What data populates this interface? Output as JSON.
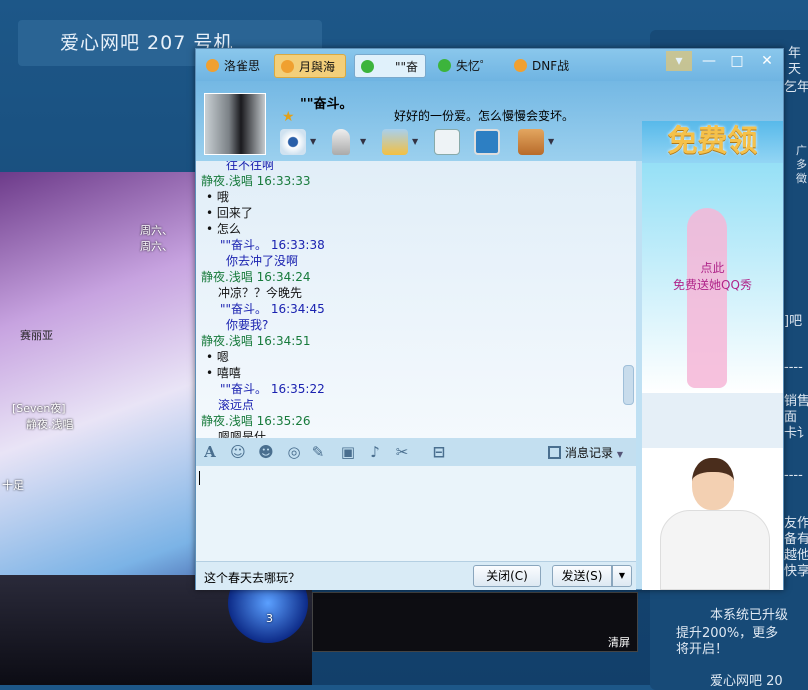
{
  "desktop": {
    "banner": "爱心网吧 207 号机",
    "right_lines": [
      "年",
      "天",
      "乞年",
      "广",
      "多",
      "徵",
      "]吧",
      "----",
      "销售",
      "面",
      "卡讠",
      "----",
      "友作",
      "备有",
      "越他",
      "快享"
    ],
    "notice": [
      "本系统已升级",
      "提升200%，更多",
      "将开启！"
    ],
    "footer": "爱心网吧 20"
  },
  "game": {
    "labels": [
      "周六、",
      "周六、",
      "赛丽亚",
      "[Seven夜]",
      "静夜.浅唱",
      "十足"
    ],
    "clear": "清屏",
    "page": "3"
  },
  "qq": {
    "tabs": [
      {
        "label": "洛雀思",
        "state": "normal"
      },
      {
        "label": "月與海",
        "state": "active"
      },
      {
        "label": "\"\"奋",
        "state": "selected"
      },
      {
        "label": "失忆゜",
        "state": "normal"
      },
      {
        "label": "DNF战",
        "state": "normal"
      }
    ],
    "window_buttons": [
      "▾",
      "—",
      "□",
      "✕"
    ],
    "contact": {
      "name": "\"\"奋斗。",
      "signature": "好好的一份爱。怎么慢慢会变坏。"
    },
    "toolbar_icons": [
      "webcam-icon",
      "microphone-icon",
      "file-transfer-icon",
      "message-add-icon",
      "remote-assist-icon",
      "app-box-icon"
    ],
    "messages": [
      {
        "cls": "b",
        "text": "往不往啊"
      },
      {
        "cls": "g",
        "text": "静夜.浅唱   16:33:33"
      },
      {
        "cls": "k",
        "text": "• 哦"
      },
      {
        "cls": "k",
        "text": "• 回来了"
      },
      {
        "cls": "k",
        "text": "• 怎么"
      },
      {
        "cls": "b",
        "text": "\"\"奋斗。   16:33:38"
      },
      {
        "cls": "b",
        "text": "你去冲了没啊"
      },
      {
        "cls": "g",
        "text": "静夜.浅唱   16:34:24"
      },
      {
        "cls": "k",
        "text": "冲凉？？今晚先"
      },
      {
        "cls": "b",
        "text": "\"\"奋斗。   16:34:45"
      },
      {
        "cls": "b",
        "text": "你要我?"
      },
      {
        "cls": "g",
        "text": "静夜.浅唱   16:34:51"
      },
      {
        "cls": "k",
        "text": "• 嗯"
      },
      {
        "cls": "k",
        "text": "• 嘻嘻"
      },
      {
        "cls": "b",
        "text": "\"\"奋斗。   16:35:22"
      },
      {
        "cls": "b",
        "text": "滚远点"
      },
      {
        "cls": "g",
        "text": "静夜.浅唱   16:35:26"
      },
      {
        "cls": "k",
        "text": "嗯嗯是什"
      }
    ],
    "input_toolbar": {
      "icons": [
        "A",
        "☺",
        "☻",
        "◎",
        "✎",
        "▣",
        "♪",
        "✂",
        "⊟"
      ],
      "history": "消息记录"
    },
    "input_value": "",
    "tip": "这个春天去哪玩？",
    "close_button": "关闭(C)",
    "send_button": "发送(S)",
    "ad": {
      "banner": "免费领",
      "line1": "点此",
      "line2": "免费送她QQ秀"
    }
  }
}
